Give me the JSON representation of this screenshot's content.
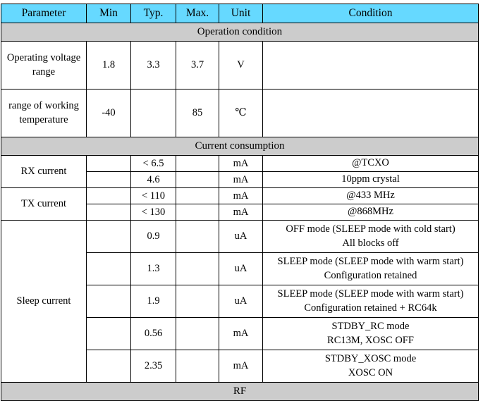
{
  "table": {
    "columns": [
      "Parameter",
      "Min",
      "Typ.",
      "Max.",
      "Unit",
      "Condition"
    ],
    "header_bg": "#66d9ff",
    "section_bg": "#cccccc",
    "sections": [
      {
        "title": "Operation condition",
        "rows": [
          {
            "parameter": "Operating voltage range",
            "min": "1.8",
            "typ": "3.3",
            "max": "3.7",
            "unit": "V",
            "condition": ""
          },
          {
            "parameter": "range of working temperature",
            "min": "-40",
            "typ": "",
            "max": "85",
            "unit": "℃",
            "condition": ""
          }
        ]
      },
      {
        "title": "Current consumption",
        "groups": [
          {
            "parameter": "RX current",
            "subrows": [
              {
                "min": "",
                "typ": "< 6.5",
                "max": "",
                "unit": "mA",
                "cond_line1": "@TCXO",
                "cond_line2": ""
              },
              {
                "min": "",
                "typ": "4.6",
                "max": "",
                "unit": "mA",
                "cond_line1": "10ppm  crystal",
                "cond_line2": ""
              }
            ]
          },
          {
            "parameter": "TX current",
            "subrows": [
              {
                "min": "",
                "typ": "< 110",
                "max": "",
                "unit": "mA",
                "cond_line1": "@433 MHz",
                "cond_line2": ""
              },
              {
                "min": "",
                "typ": "< 130",
                "max": "",
                "unit": "mA",
                "cond_line1": "@868MHz",
                "cond_line2": ""
              }
            ]
          },
          {
            "parameter": "Sleep current",
            "subrows": [
              {
                "min": "",
                "typ": "0.9",
                "max": "",
                "unit": "uA",
                "cond_line1": "OFF mode (SLEEP mode with cold start)",
                "cond_line2": "All blocks off"
              },
              {
                "min": "",
                "typ": "1.3",
                "max": "",
                "unit": "uA",
                "cond_line1": "SLEEP mode (SLEEP mode with warm start)",
                "cond_line2": "Configuration retained"
              },
              {
                "min": "",
                "typ": "1.9",
                "max": "",
                "unit": "uA",
                "cond_line1": "SLEEP mode (SLEEP mode with warm start)",
                "cond_line2": "Configuration retained + RC64k"
              },
              {
                "min": "",
                "typ": "0.56",
                "max": "",
                "unit": "mA",
                "cond_line1": "STDBY_RC mode",
                "cond_line2": "RC13M, XOSC OFF"
              },
              {
                "min": "",
                "typ": "2.35",
                "max": "",
                "unit": "mA",
                "cond_line1": "STDBY_XOSC mode",
                "cond_line2": "XOSC ON"
              }
            ]
          }
        ]
      },
      {
        "title": "RF",
        "groups": []
      }
    ]
  }
}
